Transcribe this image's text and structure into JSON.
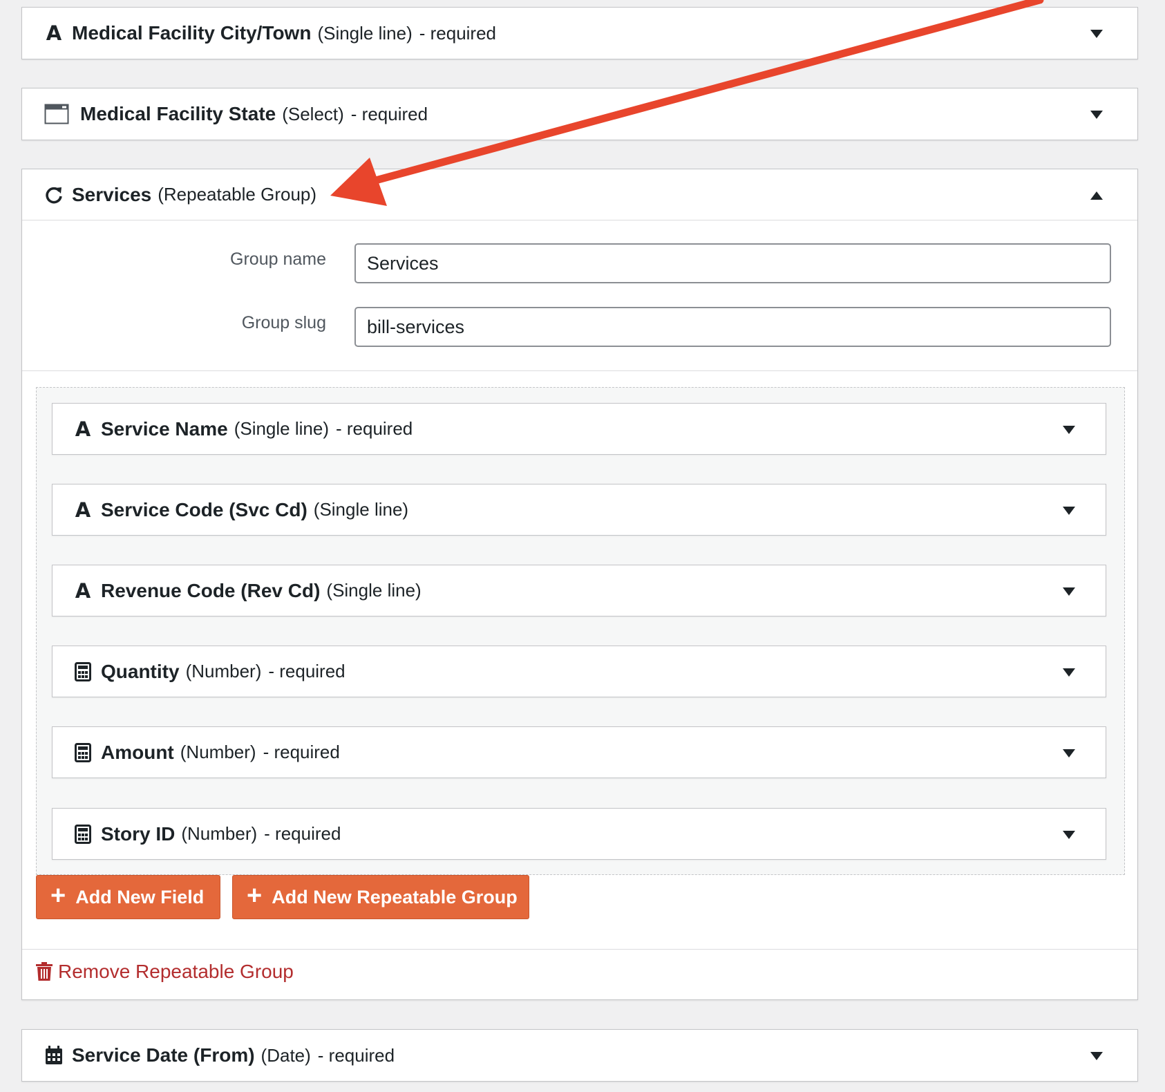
{
  "fields_top": [
    {
      "icon": "text-field-icon",
      "glyph": "A",
      "title": "Medical Facility City/Town",
      "type": "(Single line)",
      "required": "- required"
    },
    {
      "icon": "select-field-icon",
      "glyph": "",
      "title": "Medical Facility State",
      "type": "(Select)",
      "required": "- required"
    }
  ],
  "group": {
    "icon": "repeat-icon",
    "title": "Services",
    "type": "(Repeatable Group)",
    "name_label": "Group name",
    "name_value": "Services",
    "slug_label": "Group slug",
    "slug_value": "bill-services",
    "fields": [
      {
        "icon": "text-field-icon",
        "glyph": "A",
        "title": "Service Name",
        "type": "(Single line)",
        "required": "- required"
      },
      {
        "icon": "text-field-icon",
        "glyph": "A",
        "title": "Service Code (Svc Cd)",
        "type": "(Single line)",
        "required": ""
      },
      {
        "icon": "text-field-icon",
        "glyph": "A",
        "title": "Revenue Code (Rev Cd)",
        "type": "(Single line)",
        "required": ""
      },
      {
        "icon": "calculator-icon",
        "glyph": "",
        "title": "Quantity",
        "type": "(Number)",
        "required": "- required"
      },
      {
        "icon": "calculator-icon",
        "glyph": "",
        "title": "Amount",
        "type": "(Number)",
        "required": "- required"
      },
      {
        "icon": "calculator-icon",
        "glyph": "",
        "title": "Story ID",
        "type": "(Number)",
        "required": "- required"
      }
    ],
    "add_field_label": "Add New Field",
    "add_group_label": "Add New Repeatable Group",
    "remove_label": "Remove Repeatable Group"
  },
  "fields_bottom": [
    {
      "icon": "calendar-icon",
      "glyph": "",
      "title": "Service Date (From)",
      "type": "(Date)",
      "required": "- required"
    }
  ],
  "colors": {
    "accent_button": "#e4683b",
    "remove_link": "#b32d2e",
    "annotation_arrow": "#e8452c"
  }
}
